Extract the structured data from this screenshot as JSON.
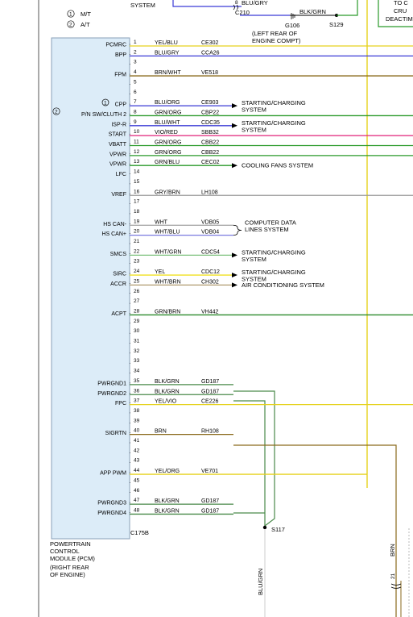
{
  "legend": {
    "items": [
      {
        "num": "1",
        "text": "M/T"
      },
      {
        "num": "2",
        "text": "A/T"
      }
    ]
  },
  "top_fragments": {
    "system_top": "SYSTEM",
    "wire_blugry": "BLU/GRY",
    "pin8": "8",
    "c210": "C210",
    "g106": "G106",
    "blkgrn": "BLK/GRN",
    "s129": "S129",
    "left_rear_1": "(LEFT REAR OF",
    "left_rear_2": "ENGINE COMPT)",
    "to_c": "TO C",
    "cru": "CRU",
    "deactim": "DEACTIM"
  },
  "pcm": {
    "label_lines": [
      "POWERTRAIN",
      "CONTROL",
      "MODULE (PCM)",
      "(RIGHT REAR",
      "OF ENGINE)"
    ],
    "connector": "C175B",
    "variant_mark": "2",
    "cpp_mark": "1"
  },
  "splice_s117": "S117",
  "vertical_labels": {
    "blugrn": "BLU/GRN",
    "brn": "BRN",
    "pin21": "21"
  },
  "rows": [
    {
      "pin": "1",
      "signal": "PCMRC",
      "color": "YEL/BLU",
      "circuit": "CE302",
      "line": "#e6d21e",
      "end": "full"
    },
    {
      "pin": "2",
      "signal": "BPP",
      "color": "BLU/GRY",
      "circuit": "CCA26",
      "line": "#3b3bd6",
      "end": "full"
    },
    {
      "pin": "3",
      "signal": "",
      "color": "",
      "circuit": "",
      "line": "",
      "end": ""
    },
    {
      "pin": "4",
      "signal": "FPM",
      "color": "BRN/WHT",
      "circuit": "VE518",
      "line": "#8a6a1c",
      "end": "full"
    },
    {
      "pin": "5",
      "signal": "",
      "color": "",
      "circuit": "",
      "line": "",
      "end": ""
    },
    {
      "pin": "6",
      "signal": "",
      "color": "",
      "circuit": "",
      "line": "",
      "end": ""
    },
    {
      "pin": "7",
      "signal": "CPP",
      "color": "BLU/ORG",
      "circuit": "CE903",
      "line": "#3b3bd6",
      "end": "arrow"
    },
    {
      "pin": "8",
      "signal": "P/N SW/CLUTH 2",
      "color": "GRN/ORG",
      "circuit": "CBP22",
      "line": "#2a9a2a",
      "end": "full"
    },
    {
      "pin": "9",
      "signal": "ISP-R",
      "color": "BLU/WHT",
      "circuit": "CDC35",
      "line": "#3b3bd6",
      "end": "arrow"
    },
    {
      "pin": "10",
      "signal": "START",
      "color": "VIO/RED",
      "circuit": "SBB32",
      "line": "#e0207a",
      "end": "full"
    },
    {
      "pin": "11",
      "signal": "VBATT",
      "color": "GRN/ORG",
      "circuit": "CBB22",
      "line": "#2a9a2a",
      "end": "full"
    },
    {
      "pin": "12",
      "signal": "VPWR",
      "color": "GRN/ORG",
      "circuit": "CBB22",
      "line": "#2a9a2a",
      "end": "full"
    },
    {
      "pin": "13",
      "signal": "VPWR",
      "color": "GRN/BLU",
      "circuit": "CEC02",
      "line": "#2a9a2a",
      "end": "arrow"
    },
    {
      "pin": "14",
      "signal": "LFC",
      "color": "",
      "circuit": "",
      "line": "",
      "end": ""
    },
    {
      "pin": "15",
      "signal": "",
      "color": "",
      "circuit": "",
      "line": "",
      "end": ""
    },
    {
      "pin": "16",
      "signal": "VREF",
      "color": "GRY/BRN",
      "circuit": "LH108",
      "line": "#999999",
      "end": "full"
    },
    {
      "pin": "17",
      "signal": "",
      "color": "",
      "circuit": "",
      "line": "",
      "end": ""
    },
    {
      "pin": "18",
      "signal": "",
      "color": "",
      "circuit": "",
      "line": "",
      "end": ""
    },
    {
      "pin": "19",
      "signal": "HS CAN-",
      "color": "WHT",
      "circuit": "VDB05",
      "line": "#aaaaaa",
      "end": "brace"
    },
    {
      "pin": "20",
      "signal": "HS CAN+",
      "color": "WHT/BLU",
      "circuit": "VDB04",
      "line": "#7a7ae0",
      "end": "brace"
    },
    {
      "pin": "21",
      "signal": "",
      "color": "",
      "circuit": "",
      "line": "",
      "end": ""
    },
    {
      "pin": "22",
      "signal": "SMCS",
      "color": "WHT/GRN",
      "circuit": "CDC54",
      "line": "#7ac07a",
      "end": "arrow"
    },
    {
      "pin": "23",
      "signal": "",
      "color": "",
      "circuit": "",
      "line": "",
      "end": ""
    },
    {
      "pin": "24",
      "signal": "SIRC",
      "color": "YEL",
      "circuit": "CDC12",
      "line": "#f0e020",
      "end": "arrow"
    },
    {
      "pin": "25",
      "signal": "ACCR",
      "color": "WHT/BRN",
      "circuit": "CH302",
      "line": "#b09a70",
      "end": "arrow"
    },
    {
      "pin": "26",
      "signal": "",
      "color": "",
      "circuit": "",
      "line": "",
      "end": ""
    },
    {
      "pin": "27",
      "signal": "",
      "color": "",
      "circuit": "",
      "line": "",
      "end": ""
    },
    {
      "pin": "28",
      "signal": "ACPT",
      "color": "GRN/BRN",
      "circuit": "VH442",
      "line": "#2a8a2a",
      "end": "full"
    },
    {
      "pin": "29",
      "signal": "",
      "color": "",
      "circuit": "",
      "line": "",
      "end": ""
    },
    {
      "pin": "30",
      "signal": "",
      "color": "",
      "circuit": "",
      "line": "",
      "end": ""
    },
    {
      "pin": "31",
      "signal": "",
      "color": "",
      "circuit": "",
      "line": "",
      "end": ""
    },
    {
      "pin": "32",
      "signal": "",
      "color": "",
      "circuit": "",
      "line": "",
      "end": ""
    },
    {
      "pin": "33",
      "signal": "",
      "color": "",
      "circuit": "",
      "line": "",
      "end": ""
    },
    {
      "pin": "34",
      "signal": "",
      "color": "",
      "circuit": "",
      "line": "",
      "end": ""
    },
    {
      "pin": "35",
      "signal": "PWRGND1",
      "color": "BLK/GRN",
      "circuit": "GD187",
      "line": "#4a8a4a",
      "end": "ground"
    },
    {
      "pin": "36",
      "signal": "PWRGND2",
      "color": "BLK/GRN",
      "circuit": "GD187",
      "line": "#4a8a4a",
      "end": "ground"
    },
    {
      "pin": "37",
      "signal": "FPC",
      "color": "YEL/VIO",
      "circuit": "CE226",
      "line": "#e6d21e",
      "end": "full"
    },
    {
      "pin": "38",
      "signal": "",
      "color": "",
      "circuit": "",
      "line": "",
      "end": ""
    },
    {
      "pin": "39",
      "signal": "",
      "color": "",
      "circuit": "",
      "line": "",
      "end": ""
    },
    {
      "pin": "40",
      "signal": "SIGRTN",
      "color": "BRN",
      "circuit": "RH108",
      "line": "#8a6a1c",
      "end": "brn"
    },
    {
      "pin": "41",
      "signal": "",
      "color": "",
      "circuit": "",
      "line": "",
      "end": ""
    },
    {
      "pin": "42",
      "signal": "",
      "color": "",
      "circuit": "",
      "line": "",
      "end": ""
    },
    {
      "pin": "43",
      "signal": "",
      "color": "",
      "circuit": "",
      "line": "",
      "end": ""
    },
    {
      "pin": "44",
      "signal": "APP PWM",
      "color": "YEL/ORG",
      "circuit": "VE701",
      "line": "#e6d21e",
      "end": "yel"
    },
    {
      "pin": "45",
      "signal": "",
      "color": "",
      "circuit": "",
      "line": "",
      "end": ""
    },
    {
      "pin": "46",
      "signal": "",
      "color": "",
      "circuit": "",
      "line": "",
      "end": ""
    },
    {
      "pin": "47",
      "signal": "PWRGND3",
      "color": "BLK/GRN",
      "circuit": "GD187",
      "line": "#4a8a4a",
      "end": "ground"
    },
    {
      "pin": "48",
      "signal": "PWRGND4",
      "color": "BLK/GRN",
      "circuit": "GD187",
      "line": "#4a8a4a",
      "end": "ground"
    }
  ],
  "callouts": [
    {
      "anchor_pin": "7",
      "lines": [
        "STARTING/CHARGING",
        "SYSTEM"
      ]
    },
    {
      "anchor_pin": "9",
      "lines": [
        "STARTING/CHARGING",
        "SYSTEM"
      ]
    },
    {
      "anchor_pin": "13",
      "lines": [
        "COOLING FANS SYSTEM"
      ]
    },
    {
      "anchor_pin": "19",
      "lines": [
        "COMPUTER DATA",
        "LINES SYSTEM"
      ]
    },
    {
      "anchor_pin": "22",
      "lines": [
        "STARTING/CHARGING",
        "SYSTEM"
      ]
    },
    {
      "anchor_pin": "24",
      "lines": [
        "STARTING/CHARGING",
        "SYSTEM"
      ]
    },
    {
      "anchor_pin": "25",
      "lines": [
        "AIR CONDITIONING SYSTEM"
      ]
    }
  ]
}
